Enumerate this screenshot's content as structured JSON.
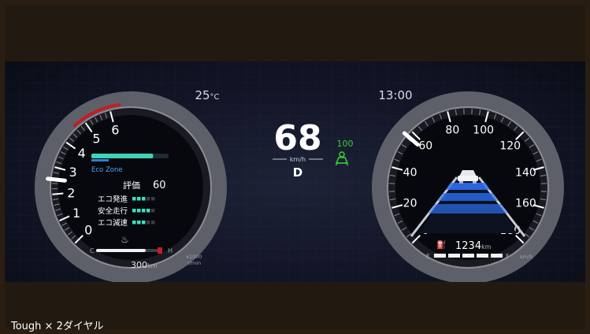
{
  "caption": "Tough × 2ダイヤル",
  "header": {
    "temperature": "25",
    "temperature_unit": "°C",
    "clock": "13:00"
  },
  "center": {
    "speed": "68",
    "speed_unit": "km/h",
    "gear": "D",
    "speed_limit": "100"
  },
  "tachometer": {
    "labels": [
      "0",
      "1",
      "2",
      "3",
      "4",
      "5",
      "6"
    ],
    "multiplier": "x1000",
    "unit": "r/min",
    "eco_zone_label": "Eco Zone",
    "eco_bar_fraction": 0.8,
    "score_label": "評価",
    "score_value": "60",
    "eco_items": [
      {
        "label": "エコ発進",
        "filled": 3,
        "total": 5
      },
      {
        "label": "安全走行",
        "filled": 4,
        "total": 5
      },
      {
        "label": "エコ減速",
        "filled": 3,
        "total": 5
      }
    ],
    "temp_low": "C",
    "temp_high": "H",
    "temp_fraction": 0.75,
    "range_value": "300",
    "range_unit": "km"
  },
  "speedometer": {
    "labels": [
      "0",
      "20",
      "40",
      "60",
      "80",
      "100",
      "120",
      "140",
      "160",
      "180"
    ],
    "unit": "km/h",
    "odometer_value": "1234",
    "odometer_unit": "km",
    "fuel_empty": "E",
    "fuel_full": "F",
    "fuel_segments": 5
  },
  "colors": {
    "eco_teal": "#3fd2b6",
    "eco_blue": "#2f7fd6",
    "eco_dot": "#39e0c0",
    "redzone": "#c41d22",
    "limit_green": "#36d23a",
    "lane_blue": "#2f74ff"
  }
}
